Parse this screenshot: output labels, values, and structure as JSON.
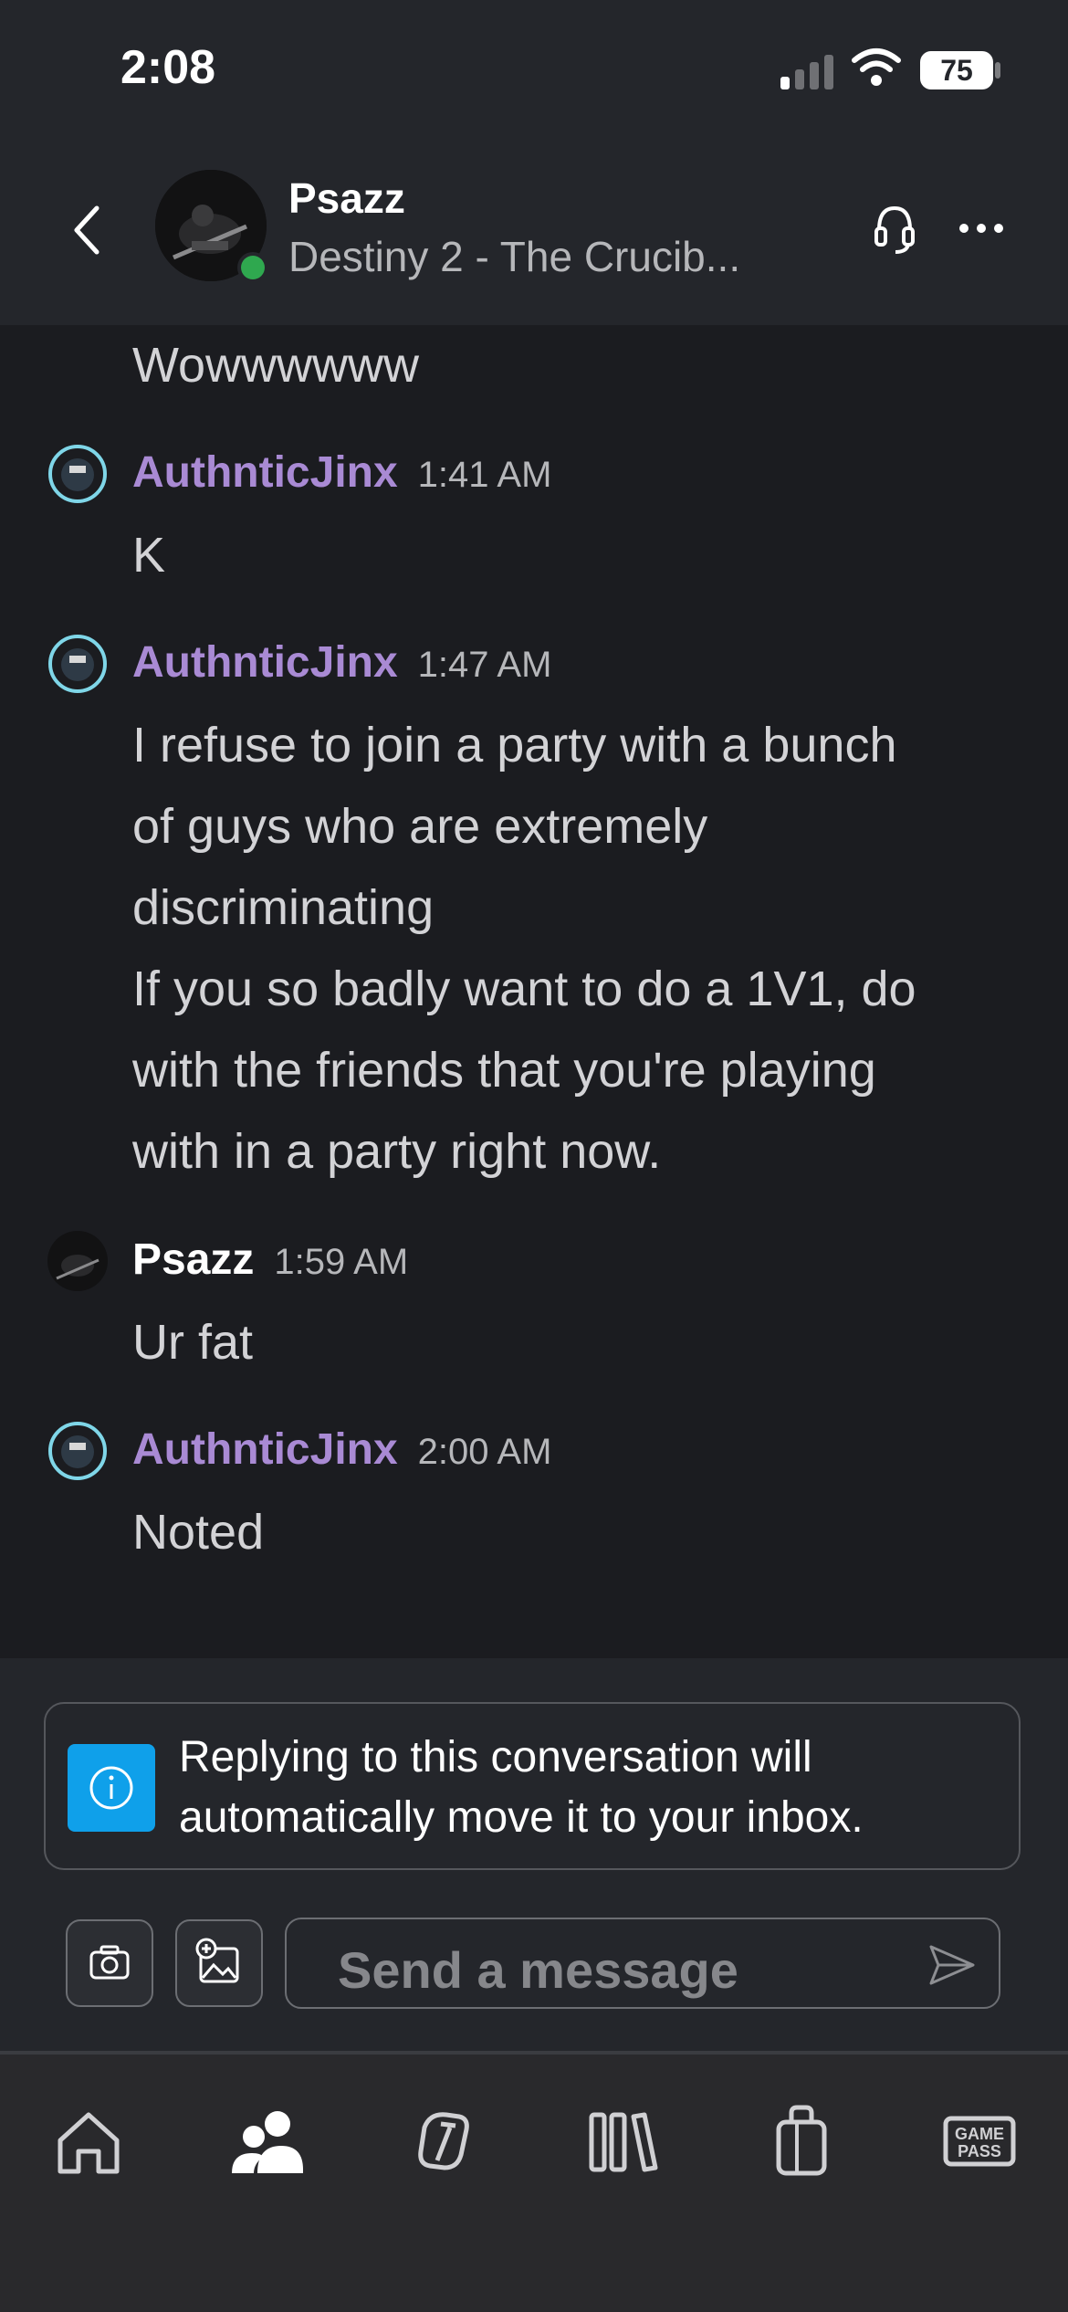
{
  "status_bar": {
    "time": "2:08",
    "battery": "75"
  },
  "header": {
    "name": "Psazz",
    "subtitle": "Destiny 2 - The Crucib..."
  },
  "messages": {
    "partial_top_text": "Wowwwwww",
    "items": [
      {
        "sender": "AuthnticJinx",
        "time": "1:41 AM",
        "lines": [
          "K"
        ]
      },
      {
        "sender": "AuthnticJinx",
        "time": "1:47 AM",
        "lines": [
          "I refuse to join a party with a bunch",
          "of guys who are extremely",
          "discriminating",
          "If you so badly want to do a 1V1, do",
          "with the friends that you're playing",
          "with in a party right now."
        ]
      },
      {
        "sender": "Psazz",
        "time": "1:59 AM",
        "lines": [
          "Ur fat"
        ]
      },
      {
        "sender": "AuthnticJinx",
        "time": "2:00 AM",
        "lines": [
          "Noted"
        ]
      }
    ]
  },
  "composer": {
    "info_line1": "Replying to this conversation will",
    "info_line2": "automatically move it to your inbox.",
    "placeholder": "Send a message"
  },
  "tab_bar": {
    "tabs": [
      "home-icon",
      "people-icon",
      "achievements-icon",
      "library-icon",
      "store-icon",
      "game-pass-icon"
    ],
    "game_pass_line1": "GAME",
    "game_pass_line2": "PASS"
  },
  "colors": {
    "accent_purple": "#a98ad4",
    "info_blue": "#0fa0ea",
    "online_green": "#2fa84f"
  }
}
